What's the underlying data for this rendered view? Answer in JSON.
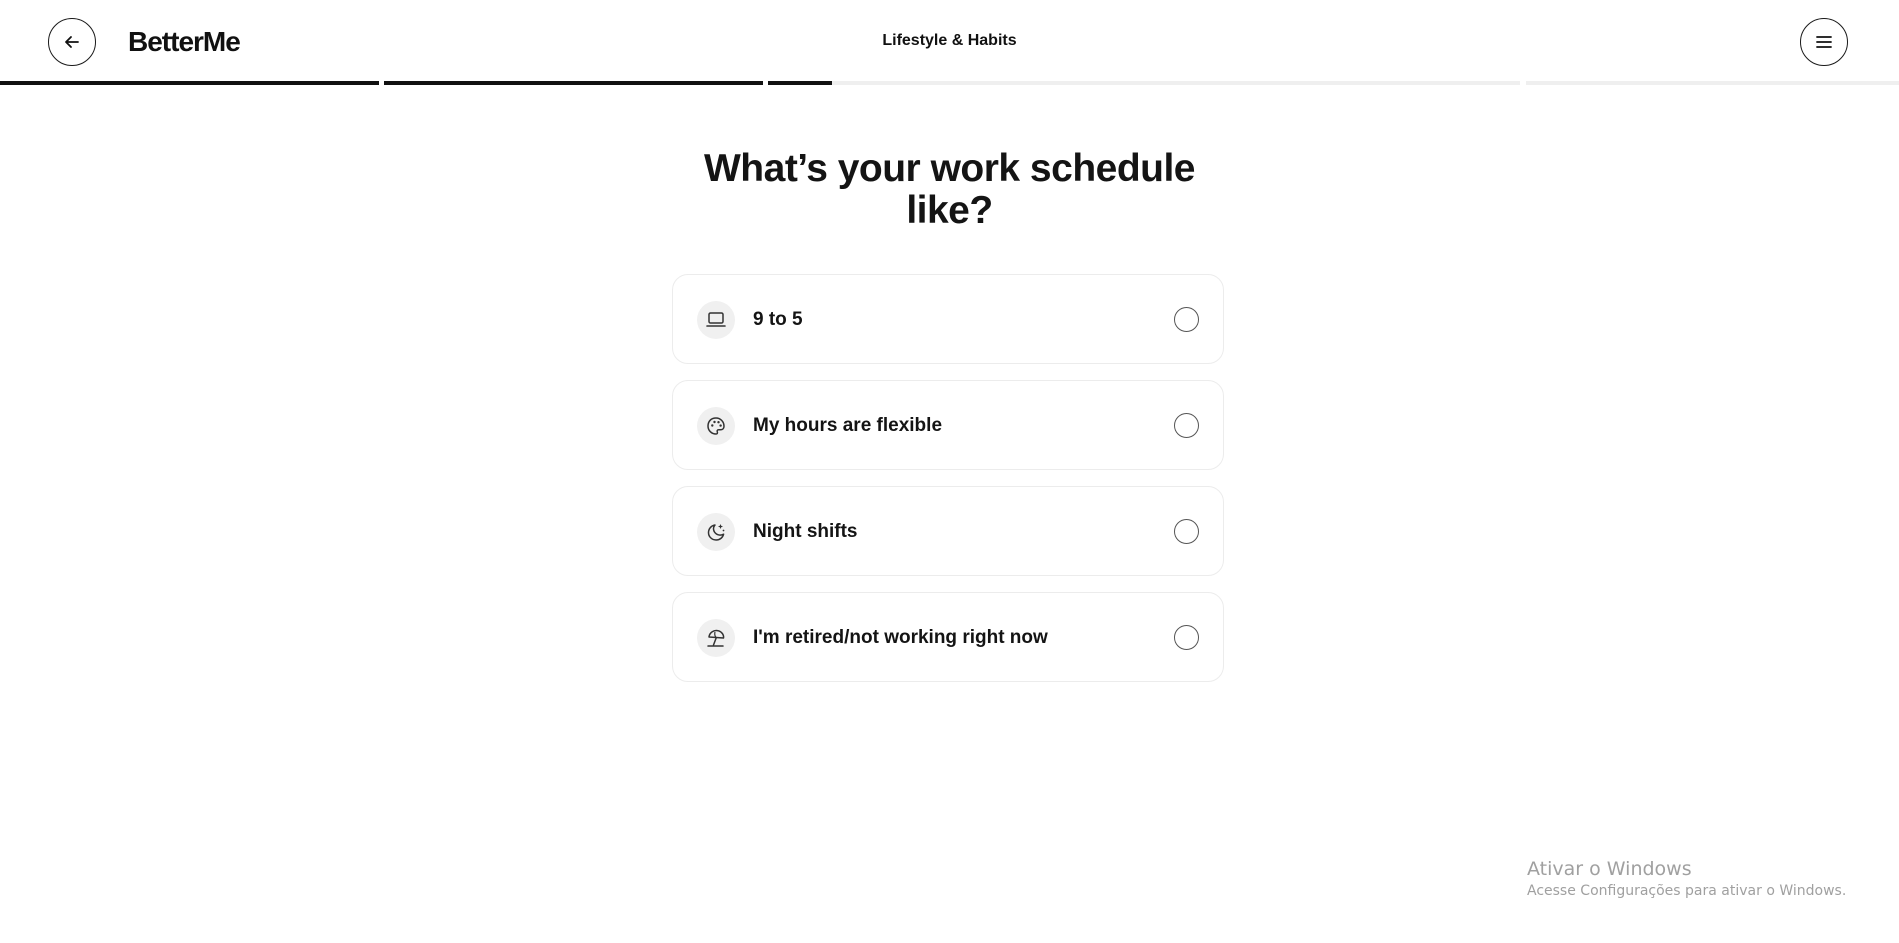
{
  "header": {
    "logo": "BetterMe",
    "section_title": "Lifestyle & Habits",
    "back_icon": "arrow-left-icon",
    "menu_icon": "hamburger-menu-icon"
  },
  "progress": {
    "segments": [
      1,
      1,
      0.17,
      0,
      0,
      0
    ]
  },
  "question": {
    "line1": "What’s your work schedule",
    "line2": "like?"
  },
  "options": [
    {
      "label": "9 to 5",
      "icon": "laptop-icon",
      "selected": false
    },
    {
      "label": "My hours are flexible",
      "icon": "palette-icon",
      "selected": false
    },
    {
      "label": "Night shifts",
      "icon": "moon-stars-icon",
      "selected": false
    },
    {
      "label": "I'm retired/not working right now",
      "icon": "beach-umbrella-icon",
      "selected": false
    }
  ],
  "watermark": {
    "title": "Ativar o Windows",
    "subtitle": "Acesse Configurações para ativar o Windows."
  },
  "colors": {
    "text": "#141414",
    "progress_fill": "#111111",
    "progress_track": "#efefef",
    "card_border": "#ececec",
    "icon_bg": "#f0f0f0"
  }
}
